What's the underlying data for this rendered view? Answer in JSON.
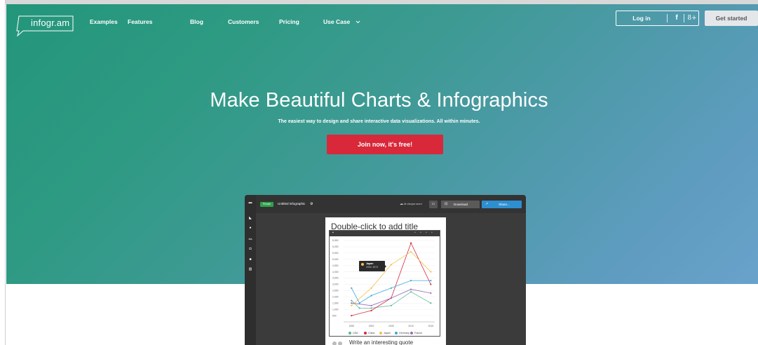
{
  "brand": {
    "name": "infogr.am"
  },
  "nav": {
    "items": [
      "Examples",
      "Features",
      "Blog",
      "Customers",
      "Pricing",
      "Use Case"
    ],
    "login": "Log in",
    "facebook": "f",
    "gplus": "8+",
    "get_started": "Get started"
  },
  "hero": {
    "title": "Make Beautiful Charts & Infographics",
    "subtitle": "The easiest way to design and share interactive data visualizations. All within minutes.",
    "cta": "Join now, it's free!"
  },
  "editor": {
    "badge": "Private",
    "title": "Untitled infographic",
    "saved": "All changes saved",
    "download": "Download",
    "share": "Share...",
    "canvas_title": "Double-click to add title",
    "quote": "Write an interesting quote",
    "tooltip": {
      "name": "Japan",
      "value": "2000: 4573"
    }
  },
  "colors": {
    "cta": "#d8283a",
    "get_started_bg": "#e4e7ea",
    "share": "#2e8fd0",
    "private_badge": "#2fa24c",
    "hero_gradient": [
      "#23967a",
      "#69a2cb"
    ]
  },
  "chart_data": {
    "type": "line",
    "x": [
      1995,
      2000,
      2005,
      2010,
      2015
    ],
    "ylim": [
      0,
      6500
    ],
    "yticks": [
      500,
      1000,
      1500,
      2000,
      2500,
      3000,
      3500,
      4000,
      4500,
      5000,
      5500,
      6000,
      6500
    ],
    "legend": "bottom",
    "series": [
      {
        "name": "USA",
        "color": "#5bb89a",
        "points": [
          [
            1995,
            1700
          ],
          [
            1997,
            1100
          ],
          [
            2000,
            1100
          ],
          [
            2005,
            1300
          ],
          [
            2010,
            2400
          ],
          [
            2015,
            1500
          ]
        ]
      },
      {
        "name": "China",
        "color": "#d8283a",
        "points": [
          [
            1995,
            500
          ],
          [
            2000,
            900
          ],
          [
            2005,
            1900
          ],
          [
            2010,
            6300
          ],
          [
            2015,
            3000
          ]
        ]
      },
      {
        "name": "Japan",
        "color": "#f4c04e",
        "points": [
          [
            1995,
            1300
          ],
          [
            2000,
            2700
          ],
          [
            2005,
            4573
          ],
          [
            2010,
            5600
          ],
          [
            2015,
            4000
          ]
        ]
      },
      {
        "name": "Germany",
        "color": "#3fa7db",
        "points": [
          [
            1995,
            2700
          ],
          [
            1997,
            1500
          ],
          [
            2000,
            2100
          ],
          [
            2005,
            2700
          ],
          [
            2010,
            3300
          ],
          [
            2015,
            3300
          ]
        ]
      },
      {
        "name": "France",
        "color": "#9b6bb7",
        "points": [
          [
            1995,
            1500
          ],
          [
            2000,
            1300
          ],
          [
            2005,
            1900
          ],
          [
            2010,
            2600
          ],
          [
            2015,
            2300
          ]
        ]
      }
    ]
  }
}
